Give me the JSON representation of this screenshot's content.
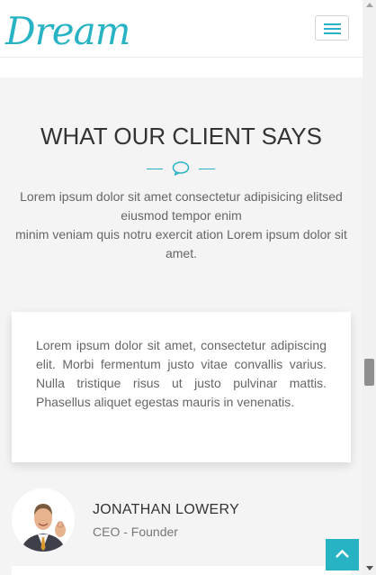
{
  "brand": {
    "logo_text": "Dream",
    "accent": "#27b3c4"
  },
  "navbar": {
    "menu_toggle_icon": "hamburger-icon"
  },
  "section": {
    "title": "WHAT OUR CLIENT SAYS",
    "divider_icon": "speech-bubble-icon",
    "intro_line_1": "Lorem ipsum dolor sit amet consectetur adipisicing elitsed eiusmod tempor enim",
    "intro_line_2": "minim veniam quis notru exercit ation Lorem ipsum dolor sit amet."
  },
  "testimonial": {
    "quote": "Lorem ipsum dolor sit amet, consectetur adipiscing elit. Morbi fermentum justo vitae convallis varius. Nulla tristique risus ut justo pulvinar mattis. Phasellus aliquet egestas mauris in venenatis.",
    "author_name": "JONATHAN LOWERY",
    "author_role": "CEO - Founder"
  },
  "back_to_top": {
    "icon": "chevron-up-icon"
  }
}
